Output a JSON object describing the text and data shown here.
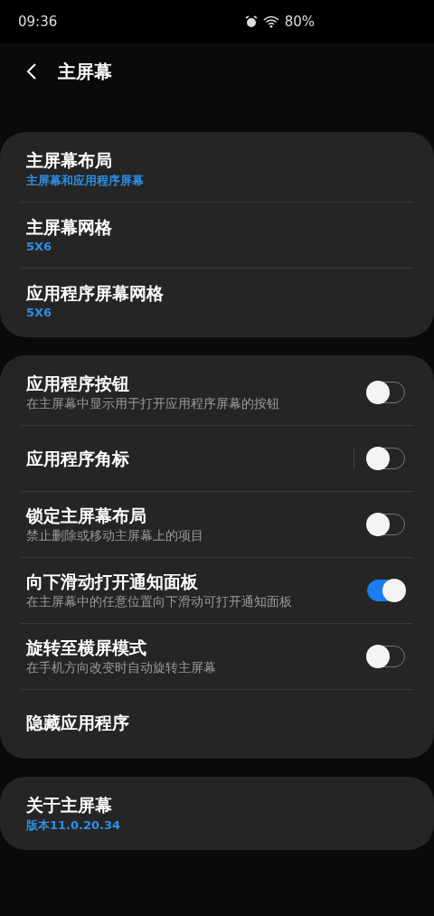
{
  "status_bar": {
    "time": "09:36",
    "battery": "80%"
  },
  "header": {
    "title": "主屏幕"
  },
  "sections": [
    {
      "items": [
        {
          "kind": "link",
          "title": "主屏幕布局",
          "summary": "主屏幕和应用程序屏幕"
        },
        {
          "kind": "link",
          "title": "主屏幕网格",
          "summary": "5X6"
        },
        {
          "kind": "link",
          "title": "应用程序屏幕网格",
          "summary": "5X6"
        }
      ]
    },
    {
      "items": [
        {
          "kind": "switch",
          "title": "应用程序按钮",
          "description": "在主屏幕中显示用于打开应用程序屏幕的按钮",
          "on": false,
          "split": false
        },
        {
          "kind": "switch",
          "title": "应用程序角标",
          "on": false,
          "split": true
        },
        {
          "kind": "switch",
          "title": "锁定主屏幕布局",
          "description": "禁止删除或移动主屏幕上的项目",
          "on": false,
          "split": false
        },
        {
          "kind": "switch",
          "title": "向下滑动打开通知面板",
          "description": "在主屏幕中的任意位置向下滑动可打开通知面板",
          "on": true,
          "split": false
        },
        {
          "kind": "switch",
          "title": "旋转至横屏模式",
          "description": "在手机方向改变时自动旋转主屏幕",
          "on": false,
          "split": false
        },
        {
          "kind": "link",
          "title": "隐藏应用程序"
        }
      ]
    },
    {
      "items": [
        {
          "kind": "link",
          "title": "关于主屏幕",
          "summary": "版本11.0.20.34"
        }
      ]
    }
  ]
}
